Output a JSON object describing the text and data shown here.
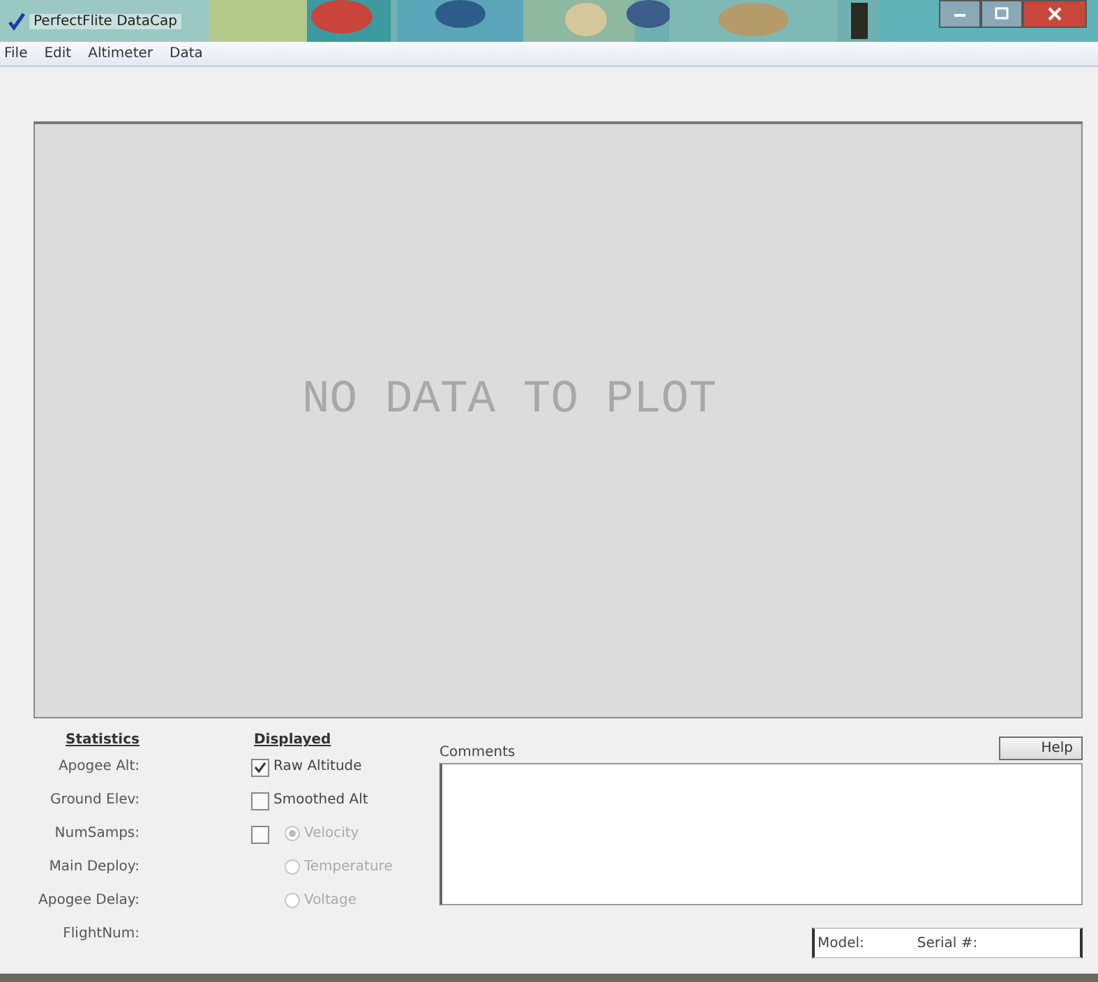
{
  "window": {
    "title": "PerfectFlite DataCap"
  },
  "menu": [
    "File",
    "Edit",
    "Altimeter",
    "Data"
  ],
  "plot": {
    "message": "NO DATA TO PLOT"
  },
  "statistics": {
    "heading": "Statistics",
    "labels": [
      "Apogee Alt:",
      "Ground Elev:",
      "NumSamps:",
      "Main Deploy:",
      "Apogee Delay:",
      "FlightNum:"
    ]
  },
  "displayed": {
    "heading": "Displayed",
    "checkboxes": [
      {
        "label": "Raw Altitude",
        "checked": true
      },
      {
        "label": "Smoothed Alt",
        "checked": false
      }
    ],
    "derived": {
      "checked": false,
      "options": [
        {
          "label": "Velocity",
          "selected": true,
          "disabled": true
        },
        {
          "label": "Temperature",
          "selected": false,
          "disabled": true
        },
        {
          "label": "Voltage",
          "selected": false,
          "disabled": true
        }
      ]
    }
  },
  "comments": {
    "label": "Comments"
  },
  "help_button": "Help",
  "status": {
    "model": "Model:",
    "serial": "Serial #:"
  }
}
